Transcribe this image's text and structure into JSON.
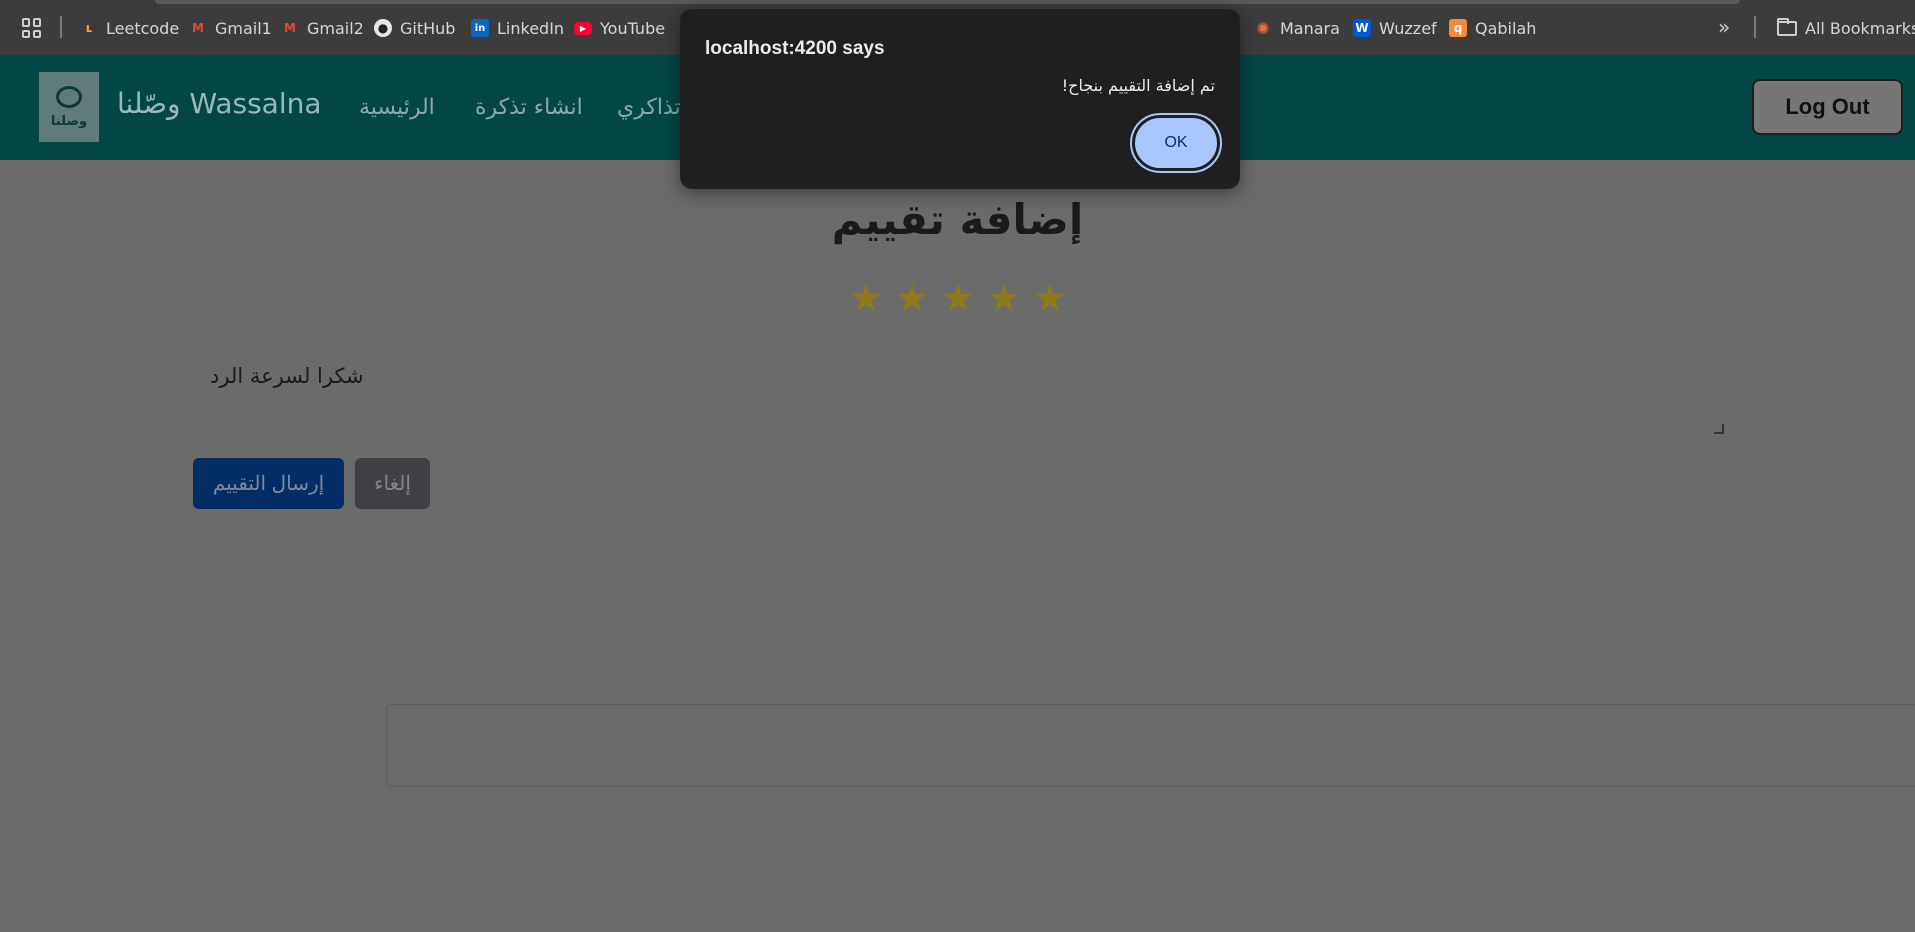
{
  "bookmarks": {
    "items": [
      {
        "label": "Leetcode",
        "icon": "leetcode-icon"
      },
      {
        "label": "Gmail1",
        "icon": "gmail-icon"
      },
      {
        "label": "Gmail2",
        "icon": "gmail-icon"
      },
      {
        "label": "GitHub",
        "icon": "github-icon"
      },
      {
        "label": "LinkedIn",
        "icon": "linkedin-icon"
      },
      {
        "label": "YouTube",
        "icon": "youtube-icon"
      },
      {
        "label": "Manara",
        "icon": "manara-icon"
      },
      {
        "label": "Wuzzef",
        "icon": "wuzzef-icon"
      },
      {
        "label": "Qabilah",
        "icon": "qabilah-icon"
      }
    ],
    "all_bookmarks_label": "All Bookmarks",
    "overflow_glyph": "»"
  },
  "navbar": {
    "logo_text": "وصلنا",
    "brand": "وصّلنا Wassalna",
    "links": [
      "الرئيسية",
      "انشاء تذكرة",
      "تذاكري"
    ],
    "logout_label": "Log Out",
    "background_color": "#034745"
  },
  "main": {
    "title": "إضافة تقييم",
    "rating": {
      "value": 5,
      "max": 5,
      "star_glyph": "★",
      "color": "#8e7a1a"
    },
    "comment": "شكرا لسرعة الرد",
    "submit_label": "إرسال التقييم",
    "cancel_label": "إلغاء"
  },
  "dialog": {
    "title": "localhost:4200 says",
    "message": "تم إضافة التقييم بنجاح!",
    "ok_label": "OK"
  }
}
